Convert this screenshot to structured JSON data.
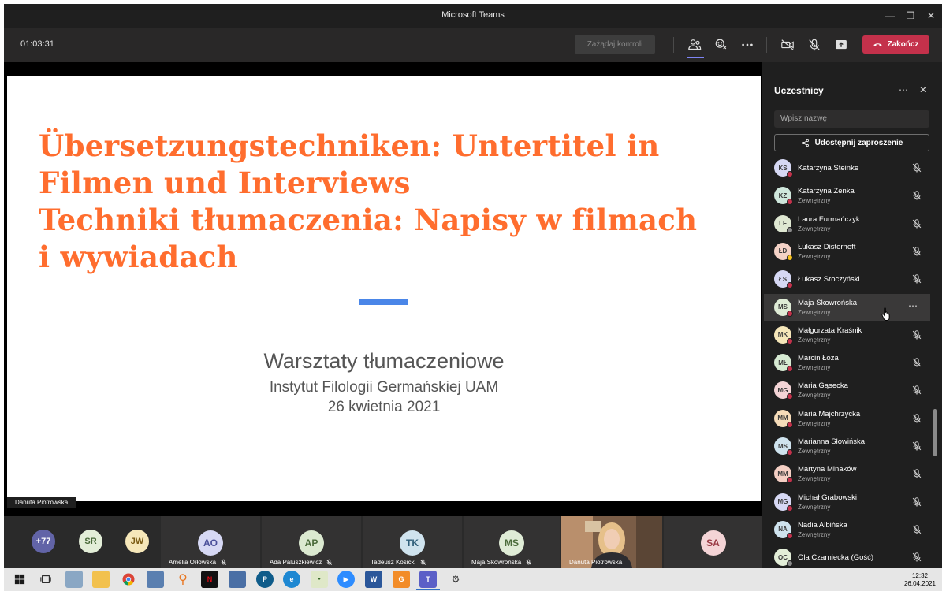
{
  "window": {
    "title": "Microsoft Teams"
  },
  "toolbar": {
    "timer": "01:03:31",
    "request_control_label": "Zażądaj kontroli",
    "end_label": "Zakończ"
  },
  "slide": {
    "title_lines": [
      "Übersetzungstechniken: Untertitel in",
      "Filmen und Interviews",
      "Techniki tłumaczenia: Napisy w filmach",
      "i wywiadach"
    ],
    "subtitle": "Warsztaty tłumaczeniowe",
    "institute": "Instytut Filologii Germańskiej UAM",
    "date": "26 kwietnia 2021",
    "title_color": "#ff6d2e",
    "accent_bar_color": "#4a86e8"
  },
  "stage": {
    "presenter_name": "Danuta Piotrowska"
  },
  "gallery": {
    "overflow_count": "+77",
    "small_avatars": [
      {
        "initials": "SR",
        "color": "#e3eed8"
      },
      {
        "initials": "JW",
        "color": "#f6e7b9"
      }
    ],
    "tiles": [
      {
        "initials": "AO",
        "name": "Amelia Orłowska",
        "color": "#d6d8f4"
      },
      {
        "initials": "AP",
        "name": "Ada Paluszkiewicz",
        "color": "#dbe9d0"
      },
      {
        "initials": "TK",
        "name": "Tadeusz Kosicki",
        "color": "#cfe3ee"
      },
      {
        "initials": "MS",
        "name": "Maja Skowrońska",
        "color": "#dfecd6"
      }
    ],
    "video_name": "Danuta Piotrowska",
    "last_tile": {
      "initials": "SA",
      "color": "#f4d4d6"
    }
  },
  "panel": {
    "title": "Uczestnicy",
    "search_placeholder": "Wpisz nazwę",
    "share_label": "Udostępnij zaproszenie",
    "external_label": "Zewnętrzny",
    "participants": [
      {
        "initials": "KS",
        "name": "Katarzyna Steinke",
        "external": false,
        "color": "#d6d8f4",
        "status": "#c4314b"
      },
      {
        "initials": "KZ",
        "name": "Katarzyna Zenka",
        "external": true,
        "color": "#cfe7dc",
        "status": "#c4314b"
      },
      {
        "initials": "LF",
        "name": "Laura Furmańczyk",
        "external": true,
        "color": "#dfe8d2",
        "status": "#8a8a8a"
      },
      {
        "initials": "ŁD",
        "name": "Łukasz Disterheft",
        "external": true,
        "color": "#f4d2c6",
        "status": "#f8c21d"
      },
      {
        "initials": "ŁS",
        "name": "Łukasz Sroczyński",
        "external": false,
        "color": "#d6d8f4",
        "status": "#c4314b"
      },
      {
        "initials": "MS",
        "name": "Maja Skowrońska",
        "external": true,
        "color": "#dfecd6",
        "status": "#c4314b"
      },
      {
        "initials": "MK",
        "name": "Małgorzata Kraśnik",
        "external": true,
        "color": "#f6e7b9",
        "status": "#c4314b"
      },
      {
        "initials": "MŁ",
        "name": "Marcin Łoza",
        "external": true,
        "color": "#d6ead2",
        "status": "#c4314b"
      },
      {
        "initials": "MG",
        "name": "Maria Gąsecka",
        "external": true,
        "color": "#f4d4d6",
        "status": "#c4314b"
      },
      {
        "initials": "MM",
        "name": "Maria Majchrzycka",
        "external": true,
        "color": "#f6dcb9",
        "status": "#c4314b"
      },
      {
        "initials": "MS",
        "name": "Marianna Słowińska",
        "external": true,
        "color": "#cfe3ee",
        "status": "#c4314b"
      },
      {
        "initials": "MM",
        "name": "Martyna Minaków",
        "external": true,
        "color": "#f4cfc4",
        "status": "#c4314b"
      },
      {
        "initials": "MG",
        "name": "Michał Grabowski",
        "external": true,
        "color": "#d6d8f4",
        "status": "#c4314b"
      },
      {
        "initials": "NA",
        "name": "Nadia Albińska",
        "external": true,
        "color": "#cfe3ee",
        "status": "#c4314b"
      },
      {
        "initials": "OC",
        "name": "Ola Czarniecka (Gość)",
        "external": false,
        "color": "#e3eed8",
        "status": "#8a8a8a"
      }
    ]
  },
  "taskbar": {
    "time": "12:32",
    "date": "26.04.2021"
  }
}
